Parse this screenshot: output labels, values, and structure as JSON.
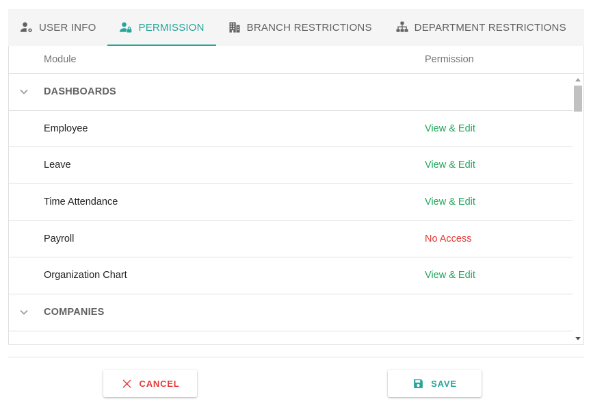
{
  "tabs": [
    {
      "label": "USER INFO",
      "icon": "user-gear-icon",
      "active": false
    },
    {
      "label": "PERMISSION",
      "icon": "user-lock-icon",
      "active": true
    },
    {
      "label": "BRANCH RESTRICTIONS",
      "icon": "building-icon",
      "active": false
    },
    {
      "label": "DEPARTMENT RESTRICTIONS",
      "icon": "sitemap-icon",
      "active": false
    }
  ],
  "grid": {
    "headers": {
      "module": "Module",
      "permission": "Permission"
    },
    "rows": [
      {
        "type": "group",
        "module": "DASHBOARDS",
        "permission": ""
      },
      {
        "type": "item",
        "module": "Employee",
        "permission": "View & Edit",
        "status": "green"
      },
      {
        "type": "item",
        "module": "Leave",
        "permission": "View & Edit",
        "status": "green"
      },
      {
        "type": "item",
        "module": "Time Attendance",
        "permission": "View & Edit",
        "status": "green"
      },
      {
        "type": "item",
        "module": "Payroll",
        "permission": "No Access",
        "status": "red"
      },
      {
        "type": "item",
        "module": "Organization Chart",
        "permission": "View & Edit",
        "status": "green"
      },
      {
        "type": "group",
        "module": "COMPANIES",
        "permission": ""
      }
    ]
  },
  "actions": {
    "cancel_label": "CANCEL",
    "save_label": "SAVE"
  },
  "colors": {
    "accent": "#26a69a",
    "allowed": "#1fa55a",
    "denied": "#e53935"
  }
}
